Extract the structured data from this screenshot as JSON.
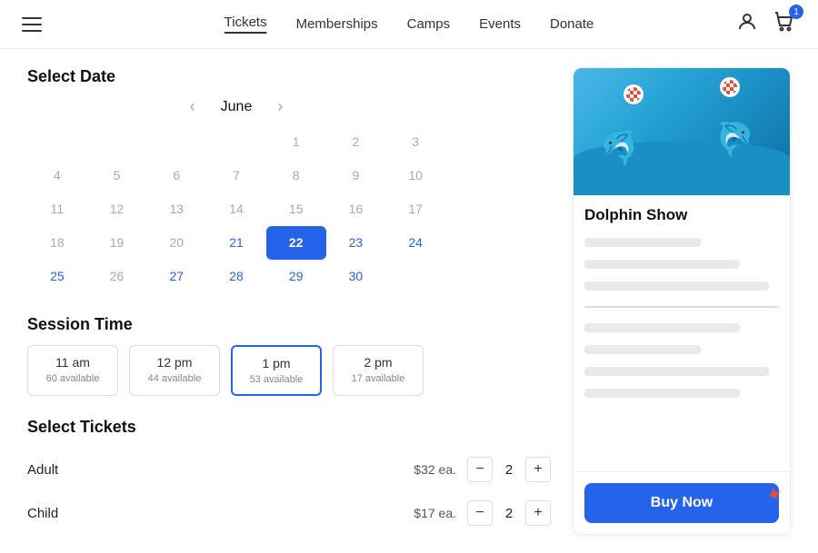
{
  "header": {
    "nav": {
      "tickets": "Tickets",
      "memberships": "Memberships",
      "camps": "Camps",
      "events": "Events",
      "donate": "Donate"
    },
    "cart_count": "1"
  },
  "calendar": {
    "title": "Select Date",
    "month": "June",
    "prev_label": "‹",
    "next_label": "›",
    "days": [
      {
        "label": "",
        "type": "empty"
      },
      {
        "label": "",
        "type": "empty"
      },
      {
        "label": "",
        "type": "empty"
      },
      {
        "label": "",
        "type": "empty"
      },
      {
        "label": "1",
        "type": "gray"
      },
      {
        "label": "2",
        "type": "gray"
      },
      {
        "label": "3",
        "type": "gray"
      },
      {
        "label": "4",
        "type": "gray"
      },
      {
        "label": "5",
        "type": "gray"
      },
      {
        "label": "6",
        "type": "gray"
      },
      {
        "label": "7",
        "type": "gray"
      },
      {
        "label": "8",
        "type": "gray"
      },
      {
        "label": "9",
        "type": "gray"
      },
      {
        "label": "10",
        "type": "gray"
      },
      {
        "label": "11",
        "type": "gray"
      },
      {
        "label": "12",
        "type": "gray"
      },
      {
        "label": "13",
        "type": "gray"
      },
      {
        "label": "14",
        "type": "gray"
      },
      {
        "label": "15",
        "type": "gray"
      },
      {
        "label": "16",
        "type": "gray"
      },
      {
        "label": "17",
        "type": "gray"
      },
      {
        "label": "18",
        "type": "gray"
      },
      {
        "label": "19",
        "type": "gray"
      },
      {
        "label": "20",
        "type": "gray"
      },
      {
        "label": "21",
        "type": "active"
      },
      {
        "label": "22",
        "type": "today"
      },
      {
        "label": "23",
        "type": "active"
      },
      {
        "label": "24",
        "type": "active"
      },
      {
        "label": "25",
        "type": "active"
      },
      {
        "label": "26",
        "type": "gray"
      },
      {
        "label": "27",
        "type": "active"
      },
      {
        "label": "28",
        "type": "active"
      },
      {
        "label": "29",
        "type": "active"
      },
      {
        "label": "30",
        "type": "active"
      }
    ]
  },
  "session": {
    "title": "Session Time",
    "options": [
      {
        "label": "11 am",
        "avail": "60 available",
        "selected": false
      },
      {
        "label": "12 pm",
        "avail": "44 available",
        "selected": false
      },
      {
        "label": "1 pm",
        "avail": "53 available",
        "selected": true
      },
      {
        "label": "2 pm",
        "avail": "17 available",
        "selected": false
      }
    ]
  },
  "tickets": {
    "title": "Select Tickets",
    "rows": [
      {
        "name": "Adult",
        "price": "$32 ea.",
        "qty": "2"
      },
      {
        "name": "Child",
        "price": "$17 ea.",
        "qty": "2"
      }
    ]
  },
  "event_card": {
    "title": "Dolphin Show",
    "buy_button": "Buy Now"
  }
}
